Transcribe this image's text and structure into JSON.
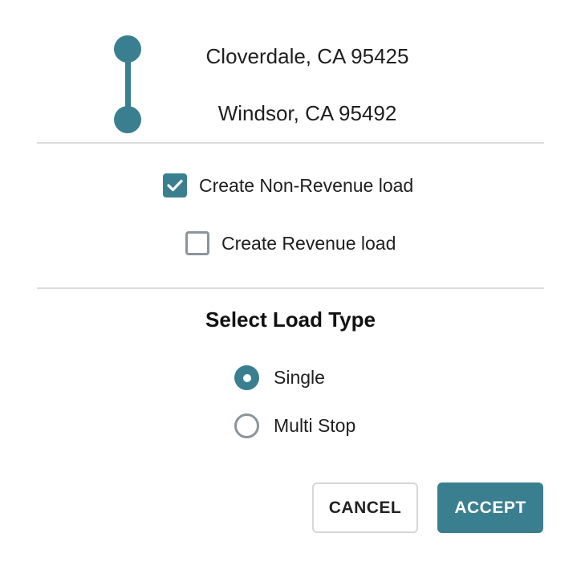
{
  "route": {
    "origin": "Cloverdale, CA 95425",
    "destination": "Windsor, CA 95492"
  },
  "options": {
    "non_revenue": {
      "label": "Create Non-Revenue load",
      "checked": true
    },
    "revenue": {
      "label": "Create Revenue load",
      "checked": false
    }
  },
  "load_type": {
    "title": "Select Load Type",
    "options": [
      {
        "label": "Single",
        "selected": true
      },
      {
        "label": "Multi Stop",
        "selected": false
      }
    ]
  },
  "actions": {
    "cancel_label": "CANCEL",
    "accept_label": "ACCEPT"
  },
  "colors": {
    "accent": "#3a7f8f",
    "unchecked_border": "#8a959b",
    "divider": "#dcdcdc"
  },
  "icons": {
    "check": "check-icon",
    "route_origin": "route-origin-dot-icon",
    "route_destination": "route-destination-dot-icon"
  }
}
